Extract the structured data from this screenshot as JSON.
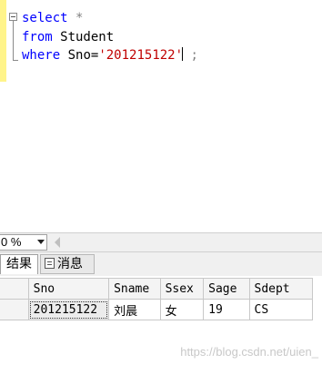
{
  "editor": {
    "line1": {
      "keyword": "select",
      "rest": " *"
    },
    "line2": {
      "keyword": "from",
      "rest": " Student"
    },
    "line3": {
      "keyword": "where",
      "column": " Sno=",
      "string": "'201215122'",
      "terminator": " ;"
    }
  },
  "zoom": {
    "value": "0 %"
  },
  "tabs": {
    "results": "结果",
    "messages": "消息"
  },
  "grid": {
    "columns": [
      "Sno",
      "Sname",
      "Ssex",
      "Sage",
      "Sdept"
    ],
    "rows": [
      [
        "201215122",
        "刘晨",
        "女",
        "19",
        "CS"
      ]
    ]
  },
  "watermark": "https://blog.csdn.net/uien_",
  "colors": {
    "keyword": "#0000ff",
    "string": "#c00000",
    "change_bar": "#fff48a"
  }
}
